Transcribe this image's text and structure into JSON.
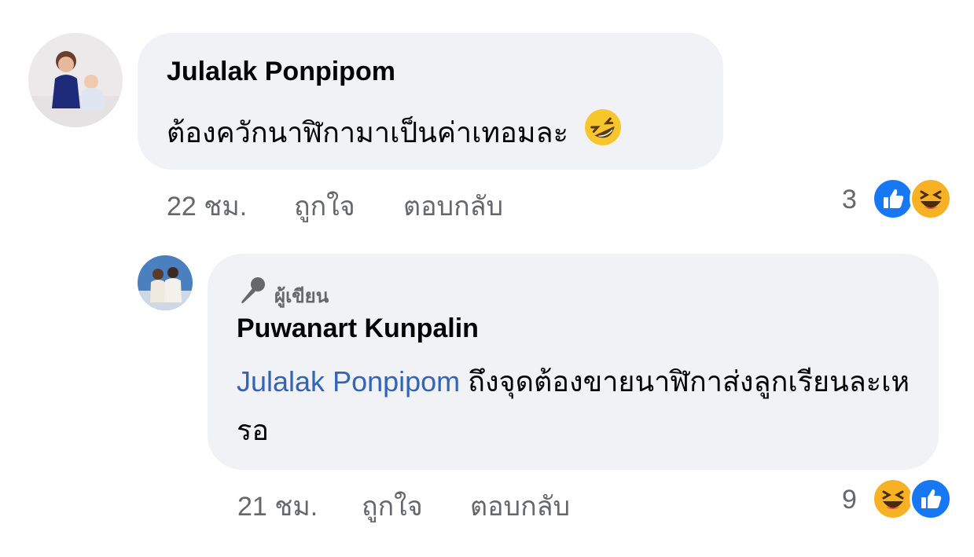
{
  "comment1": {
    "author": "Julalak Ponpipom",
    "text": "ต้องควักนาฬิกามาเป็นค่าเทอมละ",
    "time": "22 ชม.",
    "like_label": "ถูกใจ",
    "reply_label": "ตอบกลับ",
    "reaction_count": "3",
    "reactions": [
      "like-icon",
      "haha-icon"
    ]
  },
  "reply1": {
    "badge": "ผู้เขียน",
    "author": "Puwanart Kunpalin",
    "mention": "Julalak Ponpipom",
    "text": " ถึงจุดต้องขายนาฬิกาส่งลูกเรียนละเหรอ",
    "time": "21 ชม.",
    "like_label": "ถูกใจ",
    "reply_label": "ตอบกลับ",
    "reaction_count": "9",
    "reactions": [
      "haha-icon",
      "like-icon"
    ]
  },
  "colors": {
    "bubble": "#f0f2f5",
    "mention": "#3464b5",
    "like_blue": "#1877f2",
    "haha_yellow": "#f7b125",
    "meta_gray": "#65676b"
  }
}
